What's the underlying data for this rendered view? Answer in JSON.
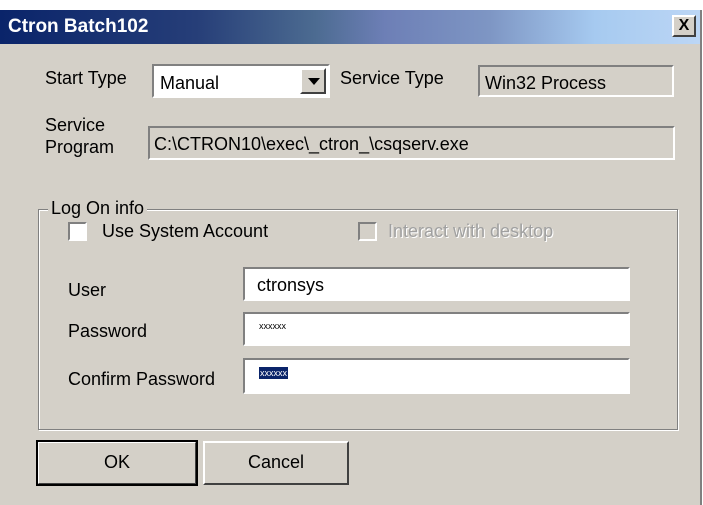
{
  "window": {
    "title": "Ctron Batch102",
    "close_symbol": "X"
  },
  "start_type": {
    "label": "Start Type",
    "value": "Manual"
  },
  "service_type": {
    "label": "Service Type",
    "value": "Win32 Process"
  },
  "service_program": {
    "label_line1": "Service",
    "label_line2": "Program",
    "value": "C:\\CTRON10\\exec\\_ctron_\\csqserv.exe"
  },
  "log_on": {
    "legend": "Log On info",
    "use_system_account": {
      "label": "Use System Account",
      "checked": false
    },
    "interact_with_desktop": {
      "label": "Interact with desktop",
      "checked": false,
      "enabled": false
    },
    "user": {
      "label": "User",
      "value": "ctronsys"
    },
    "password": {
      "label": "Password",
      "value": "xxxxxx"
    },
    "confirm_password": {
      "label": "Confirm Password",
      "value": "xxxxxx"
    }
  },
  "buttons": {
    "ok": "OK",
    "cancel": "Cancel"
  }
}
